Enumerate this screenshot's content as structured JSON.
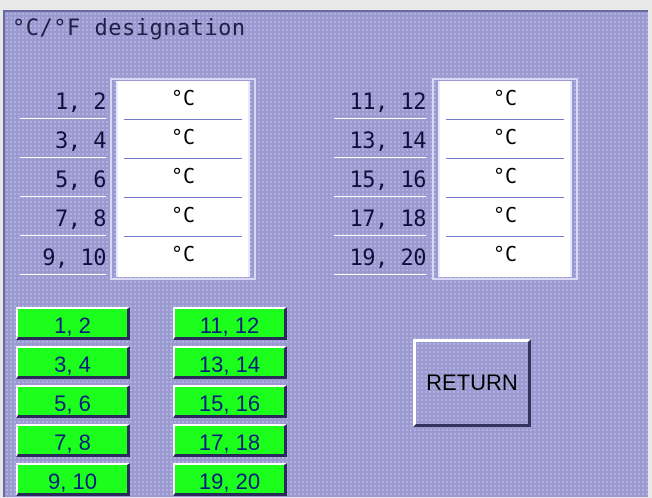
{
  "title": "°C/°F designation",
  "left_rows": [
    {
      "label": "1,  2",
      "value": "°C"
    },
    {
      "label": "3,  4",
      "value": "°C"
    },
    {
      "label": "5,  6",
      "value": "°C"
    },
    {
      "label": "7,  8",
      "value": "°C"
    },
    {
      "label": "9, 10",
      "value": "°C"
    }
  ],
  "right_rows": [
    {
      "label": "11, 12",
      "value": "°C"
    },
    {
      "label": "13, 14",
      "value": "°C"
    },
    {
      "label": "15, 16",
      "value": "°C"
    },
    {
      "label": "17, 18",
      "value": "°C"
    },
    {
      "label": "19, 20",
      "value": "°C"
    }
  ],
  "left_buttons": [
    "1, 2",
    "3, 4",
    "5, 6",
    "7, 8",
    "9, 10"
  ],
  "right_buttons": [
    "11, 12",
    "13, 14",
    "15, 16",
    "17, 18",
    "19, 20"
  ],
  "return_label": "RETURN"
}
